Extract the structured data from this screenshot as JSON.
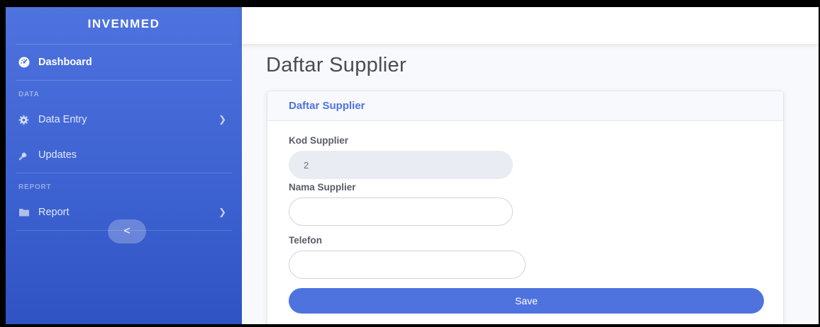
{
  "brand": "INVENMED",
  "sidebar": {
    "items": [
      {
        "label": "Dashboard",
        "icon": "tachometer-icon"
      },
      {
        "label": "Data Entry",
        "icon": "gear-icon"
      },
      {
        "label": "Updates",
        "icon": "wrench-icon"
      },
      {
        "label": "Report",
        "icon": "folder-icon"
      }
    ],
    "headings": [
      "DATA",
      "REPORT"
    ],
    "toggle_glyph": "<"
  },
  "page": {
    "title": "Daftar Supplier"
  },
  "card": {
    "header": "Daftar Supplier",
    "fields": {
      "kod": {
        "label": "Kod Supplier",
        "value": "2"
      },
      "nama": {
        "label": "Nama Supplier",
        "value": ""
      },
      "telefon": {
        "label": "Telefon",
        "value": ""
      }
    },
    "save_label": "Save"
  },
  "colors": {
    "primary": "#4e73df",
    "sidebar_dark": "#2f53c2",
    "background": "#f8f9fc"
  }
}
